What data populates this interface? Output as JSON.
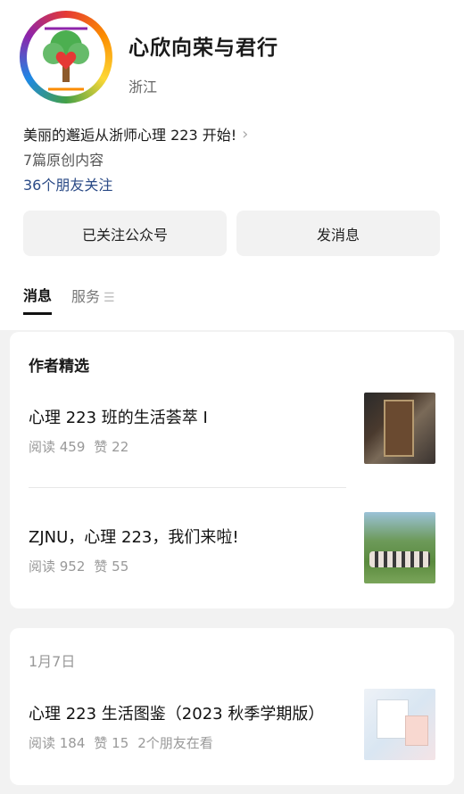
{
  "account": {
    "name": "心欣向荣与君行",
    "region": "浙江",
    "intro": "美丽的邂逅从浙师心理 223 开始!",
    "original_count": "7篇原创内容",
    "friends_follow": "36个朋友关注"
  },
  "actions": {
    "followed_label": "已关注公众号",
    "message_label": "发消息"
  },
  "tabs": [
    {
      "label": "消息",
      "active": true
    },
    {
      "label": "服务",
      "active": false
    }
  ],
  "featured": {
    "title": "作者精选",
    "articles": [
      {
        "title": "心理 223 班的生活荟萃 I",
        "reads": "阅读 459",
        "likes": "赞 22"
      },
      {
        "title": "ZJNU，心理 223，我们来啦!",
        "reads": "阅读 952",
        "likes": "赞 55"
      }
    ]
  },
  "timeline": {
    "date": "1月7日",
    "articles": [
      {
        "title": "心理 223 生活图鉴（2023 秋季学期版）",
        "reads": "阅读 184",
        "likes": "赞 15",
        "friends": "2个朋友在看"
      }
    ]
  },
  "icons": {
    "chevron": "chevron-right-icon",
    "menu": "menu-icon"
  }
}
